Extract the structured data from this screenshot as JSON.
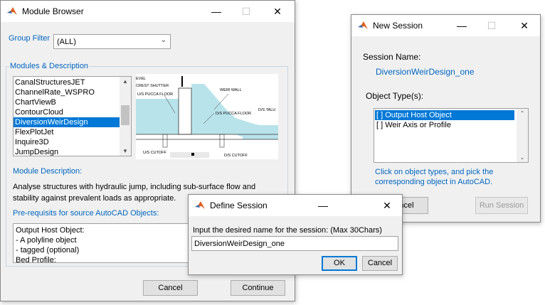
{
  "module_browser": {
    "title": "Module Browser",
    "group_filter_label": "Group Filter",
    "group_filter_value": "(ALL)",
    "modules_label": "Modules & Description",
    "modules": [
      "CanalStructuresJET",
      "ChannelRate_WSPRO",
      "ChartViewB",
      "ContourCloud",
      "DiversionWeirDesign",
      "FlexPlotJet",
      "Inquire3D",
      "JumpDesign"
    ],
    "selected_module": "DiversionWeirDesign",
    "diagram_labels": {
      "level": "EVEL",
      "crest_shutter": "CREST SHUTTER",
      "us_pucca_floor": "U/S PUCCA FLOOR",
      "weir_wall": "WEIR WALL",
      "ds_pucca_floor": "D/S PUCCA FLOOR",
      "ds_talus": "D/S TALU",
      "us_cutoff": "U/S CUTOFF",
      "ds_cutoff": "D/S CUTOFF"
    },
    "description_label": "Module Description:",
    "description_text": "Analyse structures with hydraulic jump, including sub-surface flow and stability against prevalent loads as appropriate.",
    "prereq_label": "Pre-requisits for source AutoCAD Objects:",
    "prereq_lines": [
      "Output Host Object:",
      "- A polyline object",
      "- tagged (optional)",
      "Bed Profile:"
    ],
    "cancel_label": "Cancel",
    "continue_label": "Continue"
  },
  "new_session": {
    "title": "New Session",
    "session_name_label": "Session Name:",
    "session_name_value": "DiversionWeirDesign_one",
    "object_types_label": "Object Type(s):",
    "object_types": [
      "[ ] Output Host Object",
      "[ ] Weir Axis or Profile"
    ],
    "hint": "Click on object types, and pick the corresponding object in AutoCAD.",
    "cancel_label": "Cancel",
    "run_label": "Run Session"
  },
  "define_session": {
    "title": "Define Session",
    "prompt": "Input the desired name for the session: (Max 30Chars)",
    "input_value": "DiversionWeirDesign_one",
    "ok_label": "OK",
    "cancel_label": "Cancel"
  },
  "colors": {
    "accent": "#0078d7",
    "label_blue": "#0066c0",
    "diagram_water": "#b9e3ea"
  }
}
